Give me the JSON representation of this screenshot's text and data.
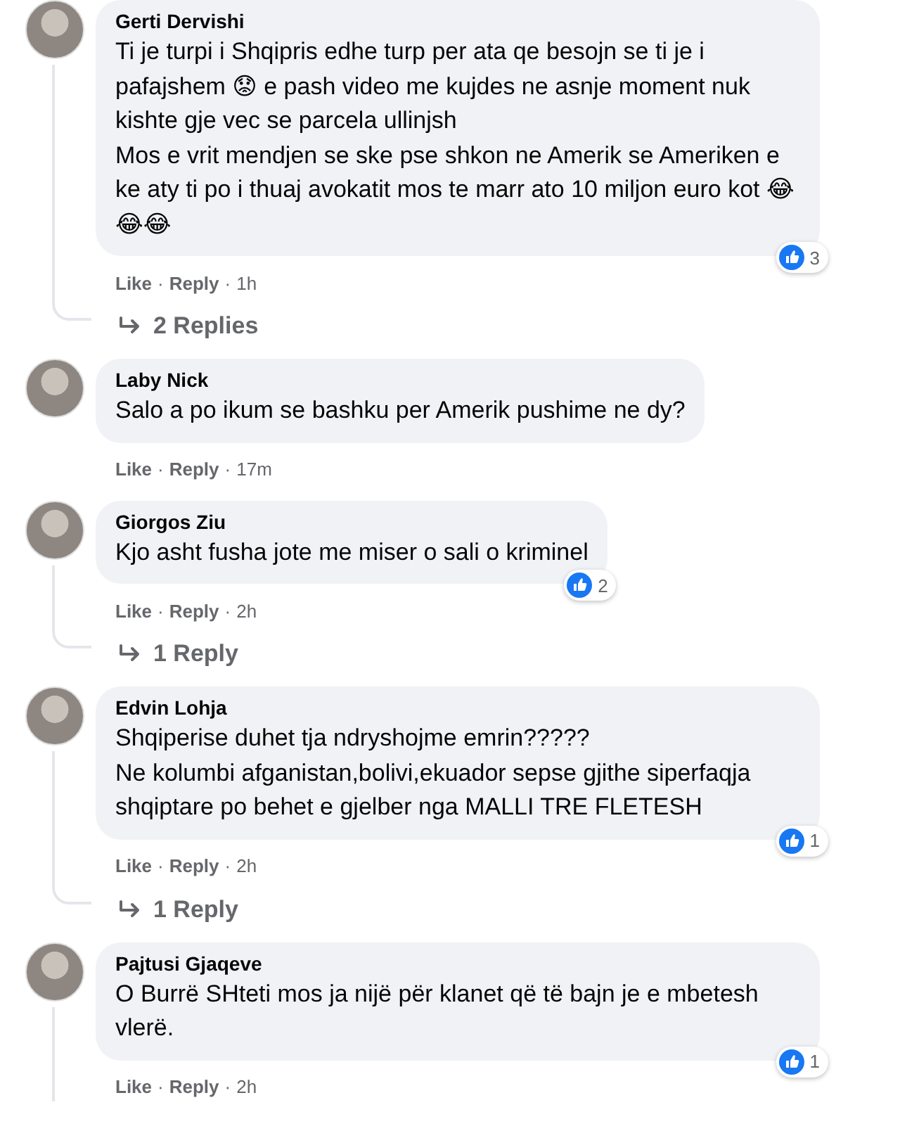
{
  "comments": [
    {
      "author": "Gerti Dervishi",
      "text": "Ti je turpi i Shqipris edhe turp per ata qe besojn se ti je i pafajshem 😟 e pash video me kujdes ne asnje moment nuk kishte gje vec se parcela ullinjsh\nMos e vrit mendjen se ske pse shkon ne Amerik se Ameriken e ke aty ti po i thuaj avokatit mos te marr ato 10 miljon euro kot 😂😂😂",
      "reaction_count": "3",
      "meta": [
        {
          "kind": "link",
          "text": "Like"
        },
        {
          "kind": "dot",
          "text": "·"
        },
        {
          "kind": "link",
          "text": "Reply"
        },
        {
          "kind": "dot",
          "text": "·"
        },
        {
          "kind": "time",
          "text": "1h"
        }
      ],
      "has_thread": true,
      "replies_link": "2 Replies"
    },
    {
      "author": "Laby Nick",
      "text": "Salo a po ikum se bashku per Amerik pushime ne dy?",
      "meta": [
        {
          "kind": "link",
          "text": "Like"
        },
        {
          "kind": "dot",
          "text": "·"
        },
        {
          "kind": "link",
          "text": "Reply"
        },
        {
          "kind": "dot",
          "text": "·"
        },
        {
          "kind": "time",
          "text": "17m"
        }
      ],
      "has_thread": false
    },
    {
      "author": "Giorgos Ziu",
      "text": "Kjo asht fusha jote me miser o sali o kriminel",
      "reaction_count": "2",
      "meta": [
        {
          "kind": "link",
          "text": "Like"
        },
        {
          "kind": "dot",
          "text": "·"
        },
        {
          "kind": "link",
          "text": "Reply"
        },
        {
          "kind": "dot",
          "text": "·"
        },
        {
          "kind": "time",
          "text": "2h"
        }
      ],
      "has_thread": true,
      "replies_link": "1 Reply"
    },
    {
      "author": "Edvin Lohja",
      "text": "Shqiperise duhet tja ndryshojme emrin?????\nNe kolumbi afganistan,bolivi,ekuador sepse gjithe siperfaqja shqiptare po behet e gjelber nga MALLI TRE FLETESH",
      "reaction_count": "1",
      "meta": [
        {
          "kind": "link",
          "text": "Like"
        },
        {
          "kind": "dot",
          "text": "·"
        },
        {
          "kind": "link",
          "text": "Reply"
        },
        {
          "kind": "dot",
          "text": "·"
        },
        {
          "kind": "time",
          "text": "2h"
        }
      ],
      "has_thread": true,
      "replies_link": "1 Reply"
    },
    {
      "author": "Pajtusi Gjaqeve",
      "text": "O Burrë SHteti mos ja nijë për klanet që të bajn je e mbetesh vlerë.",
      "reaction_count": "1",
      "meta": [
        {
          "kind": "link",
          "text": "Like"
        },
        {
          "kind": "dot",
          "text": "·"
        },
        {
          "kind": "link",
          "text": "Reply"
        },
        {
          "kind": "dot",
          "text": "·"
        },
        {
          "kind": "time",
          "text": "2h"
        }
      ],
      "has_thread": true
    }
  ]
}
